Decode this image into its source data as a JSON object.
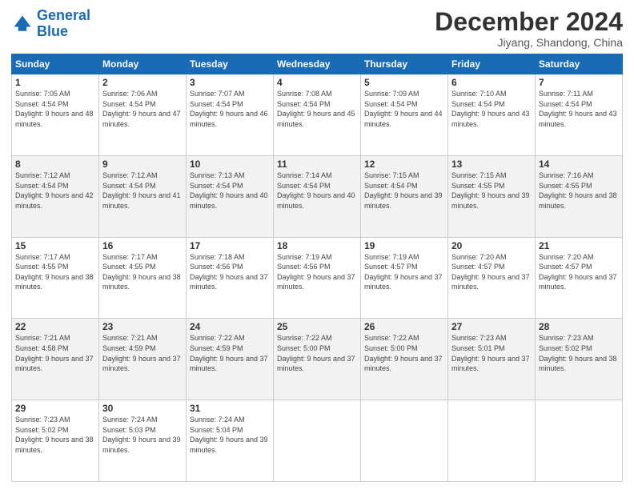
{
  "header": {
    "logo_line1": "General",
    "logo_line2": "Blue",
    "month": "December 2024",
    "location": "Jiyang, Shandong, China"
  },
  "weekdays": [
    "Sunday",
    "Monday",
    "Tuesday",
    "Wednesday",
    "Thursday",
    "Friday",
    "Saturday"
  ],
  "weeks": [
    [
      {
        "day": "1",
        "sunrise": "7:05 AM",
        "sunset": "4:54 PM",
        "daylight": "9 hours and 48 minutes."
      },
      {
        "day": "2",
        "sunrise": "7:06 AM",
        "sunset": "4:54 PM",
        "daylight": "9 hours and 47 minutes."
      },
      {
        "day": "3",
        "sunrise": "7:07 AM",
        "sunset": "4:54 PM",
        "daylight": "9 hours and 46 minutes."
      },
      {
        "day": "4",
        "sunrise": "7:08 AM",
        "sunset": "4:54 PM",
        "daylight": "9 hours and 45 minutes."
      },
      {
        "day": "5",
        "sunrise": "7:09 AM",
        "sunset": "4:54 PM",
        "daylight": "9 hours and 44 minutes."
      },
      {
        "day": "6",
        "sunrise": "7:10 AM",
        "sunset": "4:54 PM",
        "daylight": "9 hours and 43 minutes."
      },
      {
        "day": "7",
        "sunrise": "7:11 AM",
        "sunset": "4:54 PM",
        "daylight": "9 hours and 43 minutes."
      }
    ],
    [
      {
        "day": "8",
        "sunrise": "7:12 AM",
        "sunset": "4:54 PM",
        "daylight": "9 hours and 42 minutes."
      },
      {
        "day": "9",
        "sunrise": "7:12 AM",
        "sunset": "4:54 PM",
        "daylight": "9 hours and 41 minutes."
      },
      {
        "day": "10",
        "sunrise": "7:13 AM",
        "sunset": "4:54 PM",
        "daylight": "9 hours and 40 minutes."
      },
      {
        "day": "11",
        "sunrise": "7:14 AM",
        "sunset": "4:54 PM",
        "daylight": "9 hours and 40 minutes."
      },
      {
        "day": "12",
        "sunrise": "7:15 AM",
        "sunset": "4:54 PM",
        "daylight": "9 hours and 39 minutes."
      },
      {
        "day": "13",
        "sunrise": "7:15 AM",
        "sunset": "4:55 PM",
        "daylight": "9 hours and 39 minutes."
      },
      {
        "day": "14",
        "sunrise": "7:16 AM",
        "sunset": "4:55 PM",
        "daylight": "9 hours and 38 minutes."
      }
    ],
    [
      {
        "day": "15",
        "sunrise": "7:17 AM",
        "sunset": "4:55 PM",
        "daylight": "9 hours and 38 minutes."
      },
      {
        "day": "16",
        "sunrise": "7:17 AM",
        "sunset": "4:55 PM",
        "daylight": "9 hours and 38 minutes."
      },
      {
        "day": "17",
        "sunrise": "7:18 AM",
        "sunset": "4:56 PM",
        "daylight": "9 hours and 37 minutes."
      },
      {
        "day": "18",
        "sunrise": "7:19 AM",
        "sunset": "4:56 PM",
        "daylight": "9 hours and 37 minutes."
      },
      {
        "day": "19",
        "sunrise": "7:19 AM",
        "sunset": "4:57 PM",
        "daylight": "9 hours and 37 minutes."
      },
      {
        "day": "20",
        "sunrise": "7:20 AM",
        "sunset": "4:57 PM",
        "daylight": "9 hours and 37 minutes."
      },
      {
        "day": "21",
        "sunrise": "7:20 AM",
        "sunset": "4:57 PM",
        "daylight": "9 hours and 37 minutes."
      }
    ],
    [
      {
        "day": "22",
        "sunrise": "7:21 AM",
        "sunset": "4:58 PM",
        "daylight": "9 hours and 37 minutes."
      },
      {
        "day": "23",
        "sunrise": "7:21 AM",
        "sunset": "4:59 PM",
        "daylight": "9 hours and 37 minutes."
      },
      {
        "day": "24",
        "sunrise": "7:22 AM",
        "sunset": "4:59 PM",
        "daylight": "9 hours and 37 minutes."
      },
      {
        "day": "25",
        "sunrise": "7:22 AM",
        "sunset": "5:00 PM",
        "daylight": "9 hours and 37 minutes."
      },
      {
        "day": "26",
        "sunrise": "7:22 AM",
        "sunset": "5:00 PM",
        "daylight": "9 hours and 37 minutes."
      },
      {
        "day": "27",
        "sunrise": "7:23 AM",
        "sunset": "5:01 PM",
        "daylight": "9 hours and 37 minutes."
      },
      {
        "day": "28",
        "sunrise": "7:23 AM",
        "sunset": "5:02 PM",
        "daylight": "9 hours and 38 minutes."
      }
    ],
    [
      {
        "day": "29",
        "sunrise": "7:23 AM",
        "sunset": "5:02 PM",
        "daylight": "9 hours and 38 minutes."
      },
      {
        "day": "30",
        "sunrise": "7:24 AM",
        "sunset": "5:03 PM",
        "daylight": "9 hours and 39 minutes."
      },
      {
        "day": "31",
        "sunrise": "7:24 AM",
        "sunset": "5:04 PM",
        "daylight": "9 hours and 39 minutes."
      },
      null,
      null,
      null,
      null
    ]
  ]
}
